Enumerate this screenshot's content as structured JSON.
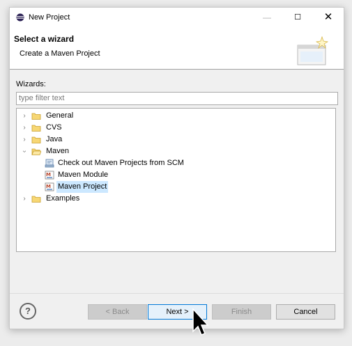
{
  "window": {
    "title": "New Project",
    "controls": {
      "minimize": "—",
      "maximize": "☐",
      "close": "✕"
    }
  },
  "header": {
    "title": "Select a wizard",
    "subtitle": "Create a Maven Project"
  },
  "wizards": {
    "label": "Wizards:",
    "filter_placeholder": "type filter text"
  },
  "tree": {
    "items": [
      {
        "label": "General",
        "expanded": false,
        "icon": "folder-icon"
      },
      {
        "label": "CVS",
        "expanded": false,
        "icon": "folder-icon"
      },
      {
        "label": "Java",
        "expanded": false,
        "icon": "folder-icon"
      },
      {
        "label": "Maven",
        "expanded": true,
        "icon": "folder-open-icon",
        "children": [
          {
            "label": "Check out Maven Projects from SCM",
            "icon": "scm-checkout-icon"
          },
          {
            "label": "Maven Module",
            "icon": "maven-module-icon"
          },
          {
            "label": "Maven Project",
            "icon": "maven-project-icon",
            "selected": true
          }
        ]
      },
      {
        "label": "Examples",
        "expanded": false,
        "icon": "folder-icon"
      }
    ]
  },
  "buttons": {
    "help": "?",
    "back": "< Back",
    "next": "Next >",
    "finish": "Finish",
    "cancel": "Cancel"
  },
  "colors": {
    "selection": "#cce8ff",
    "default_button_border": "#0078d7",
    "folder": "#e8c15a"
  }
}
